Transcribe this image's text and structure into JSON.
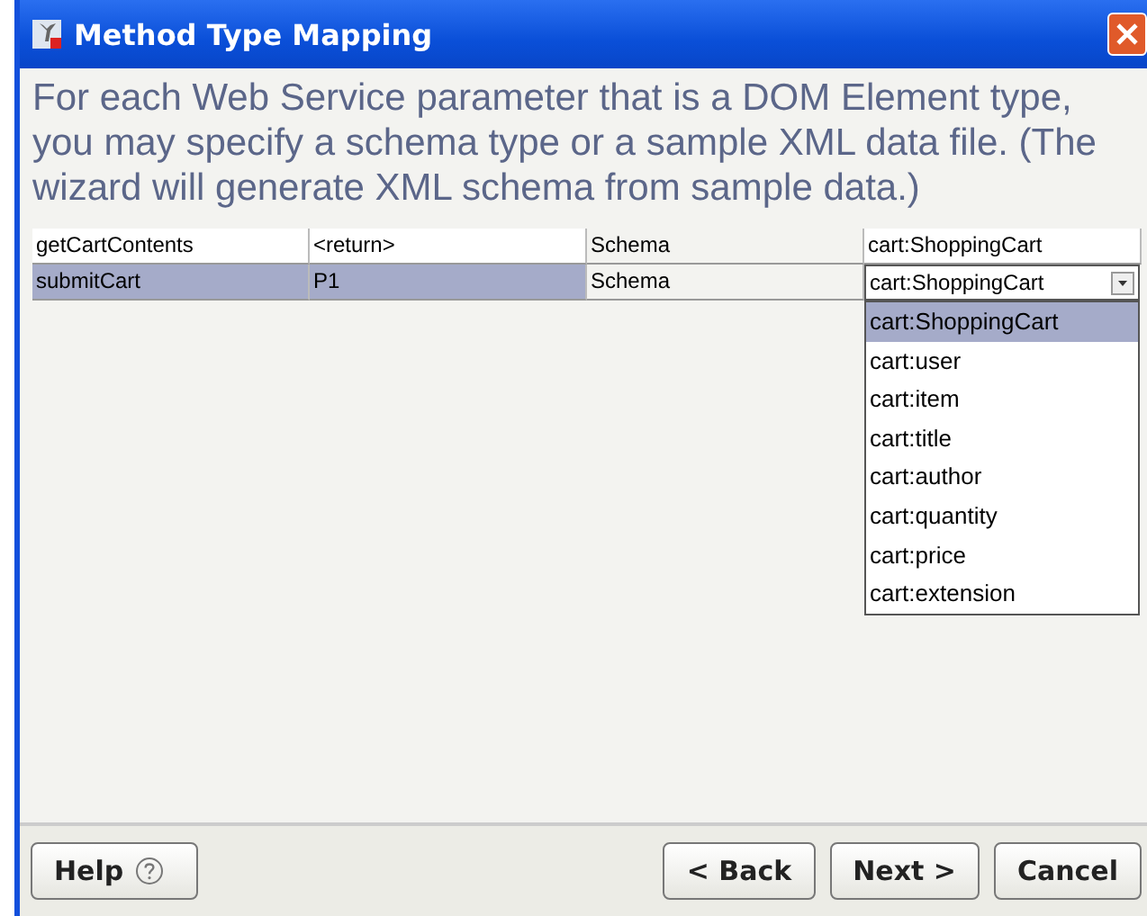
{
  "window": {
    "title": "Method Type Mapping"
  },
  "description": "For each Web Service parameter that is a DOM Element type, you may specify a schema type or a sample XML data file.  (The wizard will generate XML schema from sample data.)",
  "table": {
    "rows": [
      {
        "method": "getCartContents",
        "parameter": "<return>",
        "source": "Schema",
        "type": "cart:ShoppingCart",
        "selected": false,
        "editing": false
      },
      {
        "method": "submitCart",
        "parameter": "P1",
        "source": "Schema",
        "type": "cart:ShoppingCart",
        "selected": true,
        "editing": true
      }
    ]
  },
  "dropdown": {
    "open": true,
    "options": [
      {
        "label": "cart:ShoppingCart",
        "selected": true
      },
      {
        "label": "cart:user",
        "selected": false
      },
      {
        "label": "cart:item",
        "selected": false
      },
      {
        "label": "cart:title",
        "selected": false
      },
      {
        "label": "cart:author",
        "selected": false
      },
      {
        "label": "cart:quantity",
        "selected": false
      },
      {
        "label": "cart:price",
        "selected": false
      },
      {
        "label": "cart:extension",
        "selected": false
      }
    ]
  },
  "buttons": [
    {
      "label": "Help",
      "kind": "help"
    },
    {
      "label": "< Back",
      "kind": "nav"
    },
    {
      "label": "Next >",
      "kind": "nav"
    },
    {
      "label": "Cancel",
      "kind": "nav"
    }
  ]
}
